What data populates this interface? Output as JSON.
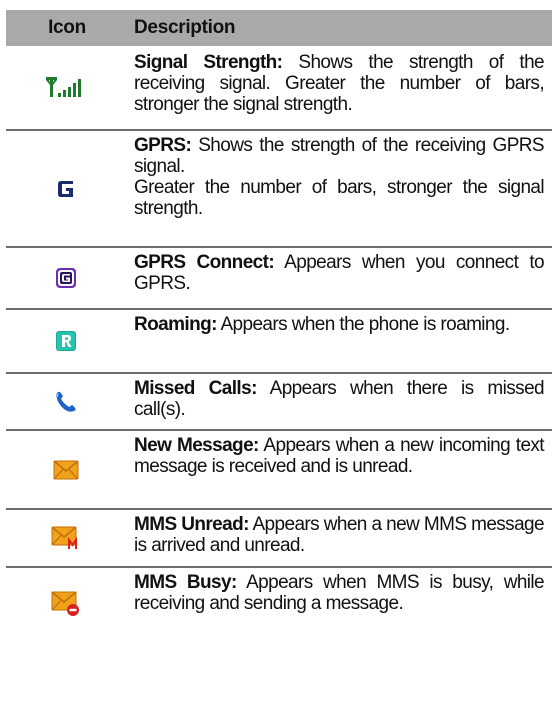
{
  "header": {
    "icon_col": "Icon",
    "desc_col": "Description"
  },
  "rows": [
    {
      "icon": "signal-strength-icon",
      "term": "Signal Strength:",
      "lines": [
        "Shows the strength of the receiving signal. Greater the number of bars, stronger the signal strength."
      ]
    },
    {
      "icon": "gprs-icon",
      "term": "GPRS:",
      "lines": [
        "Shows the strength of the receiving GPRS signal.",
        "Greater the number of bars, stronger the signal strength."
      ]
    },
    {
      "icon": "gprs-connect-icon",
      "term": "GPRS Connect:",
      "lines": [
        "Appears when you connect to GPRS."
      ]
    },
    {
      "icon": "roaming-icon",
      "term": "Roaming:",
      "lines": [
        "Appears when the phone is roaming."
      ]
    },
    {
      "icon": "missed-calls-icon",
      "term": "Missed Calls:",
      "lines": [
        "Appears when there is missed call(s)."
      ]
    },
    {
      "icon": "new-message-icon",
      "term": "New Message:",
      "lines": [
        "Appears when a new incoming text message is received and is unread."
      ]
    },
    {
      "icon": "mms-unread-icon",
      "term": "MMS Unread:",
      "lines": [
        "Appears when a new MMS message is arrived and unread."
      ]
    },
    {
      "icon": "mms-busy-icon",
      "term": "MMS Busy:",
      "lines": [
        "Appears when MMS is busy, while receiving and sending a message."
      ]
    }
  ],
  "colors": {
    "header_bg": "#a9a9a9",
    "rule": "#6e6e6e",
    "signal_green": "#1f7a2e",
    "gprs_navy": "#1b2a6b",
    "gprs_connect_purple": "#6a2fb0",
    "roaming_teal": "#1aa88c",
    "missed_call_blue": "#1e63c8",
    "message_orange": "#f0a21a",
    "mms_red": "#d82020"
  }
}
